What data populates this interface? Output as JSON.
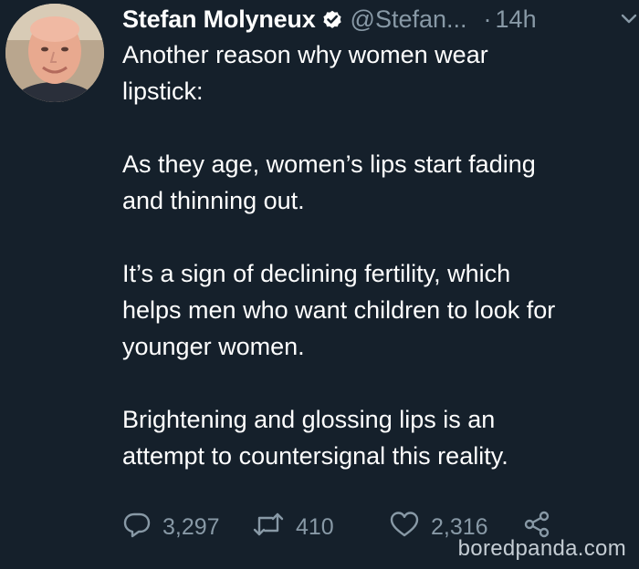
{
  "tweet": {
    "author_name": "Stefan Molyneux",
    "handle": "@Stefan...",
    "separator": "·",
    "time": "14h",
    "paragraphs": [
      "Another reason why women wear\nlipstick:",
      "As they age, women’s lips start fading\nand thinning out.",
      "It’s a sign of declining fertility, which\nhelps men who want children to look for\nyounger women.",
      "Brightening and glossing lips is an\nattempt to countersignal this reality."
    ],
    "reply_count": "3,297",
    "retweet_count": "410",
    "like_count": "2,316",
    "icons": {
      "verified": "verified-badge-icon",
      "caret": "chevron-down-icon",
      "reply": "reply-icon",
      "retweet": "retweet-icon",
      "like": "heart-icon",
      "share": "share-icon"
    }
  },
  "watermark": "boredpanda.com",
  "colors": {
    "background": "#15202b",
    "text": "#ffffff",
    "secondary": "#8899a6"
  }
}
